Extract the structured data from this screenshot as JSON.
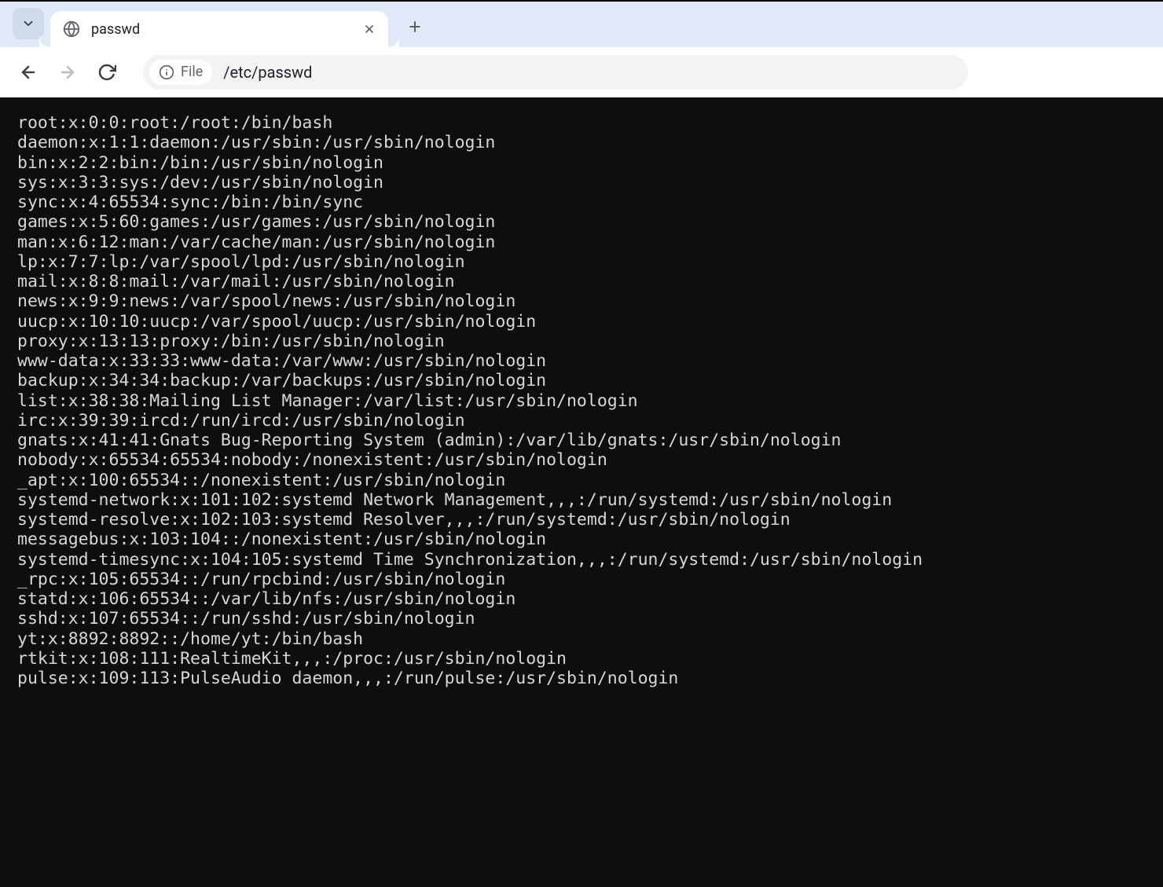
{
  "tab": {
    "title": "passwd"
  },
  "omnibox": {
    "chip_label": "File",
    "url": "/etc/passwd"
  },
  "file_lines": [
    "root:x:0:0:root:/root:/bin/bash",
    "daemon:x:1:1:daemon:/usr/sbin:/usr/sbin/nologin",
    "bin:x:2:2:bin:/bin:/usr/sbin/nologin",
    "sys:x:3:3:sys:/dev:/usr/sbin/nologin",
    "sync:x:4:65534:sync:/bin:/bin/sync",
    "games:x:5:60:games:/usr/games:/usr/sbin/nologin",
    "man:x:6:12:man:/var/cache/man:/usr/sbin/nologin",
    "lp:x:7:7:lp:/var/spool/lpd:/usr/sbin/nologin",
    "mail:x:8:8:mail:/var/mail:/usr/sbin/nologin",
    "news:x:9:9:news:/var/spool/news:/usr/sbin/nologin",
    "uucp:x:10:10:uucp:/var/spool/uucp:/usr/sbin/nologin",
    "proxy:x:13:13:proxy:/bin:/usr/sbin/nologin",
    "www-data:x:33:33:www-data:/var/www:/usr/sbin/nologin",
    "backup:x:34:34:backup:/var/backups:/usr/sbin/nologin",
    "list:x:38:38:Mailing List Manager:/var/list:/usr/sbin/nologin",
    "irc:x:39:39:ircd:/run/ircd:/usr/sbin/nologin",
    "gnats:x:41:41:Gnats Bug-Reporting System (admin):/var/lib/gnats:/usr/sbin/nologin",
    "nobody:x:65534:65534:nobody:/nonexistent:/usr/sbin/nologin",
    "_apt:x:100:65534::/nonexistent:/usr/sbin/nologin",
    "systemd-network:x:101:102:systemd Network Management,,,:/run/systemd:/usr/sbin/nologin",
    "systemd-resolve:x:102:103:systemd Resolver,,,:/run/systemd:/usr/sbin/nologin",
    "messagebus:x:103:104::/nonexistent:/usr/sbin/nologin",
    "systemd-timesync:x:104:105:systemd Time Synchronization,,,:/run/systemd:/usr/sbin/nologin",
    "_rpc:x:105:65534::/run/rpcbind:/usr/sbin/nologin",
    "statd:x:106:65534::/var/lib/nfs:/usr/sbin/nologin",
    "sshd:x:107:65534::/run/sshd:/usr/sbin/nologin",
    "yt:x:8892:8892::/home/yt:/bin/bash",
    "rtkit:x:108:111:RealtimeKit,,,:/proc:/usr/sbin/nologin",
    "pulse:x:109:113:PulseAudio daemon,,,:/run/pulse:/usr/sbin/nologin"
  ]
}
